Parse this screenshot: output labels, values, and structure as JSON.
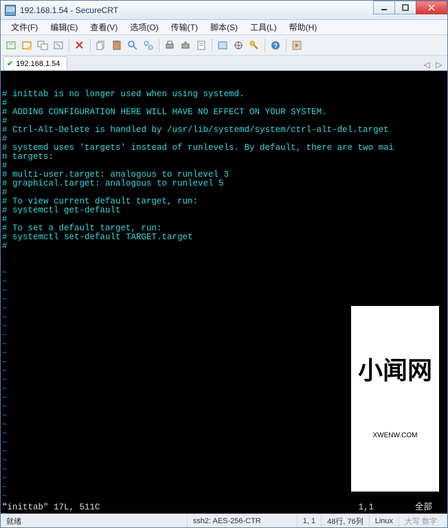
{
  "window": {
    "title": "192.168.1.54 - SecureCRT"
  },
  "menu": [
    "文件(F)",
    "编辑(E)",
    "查看(V)",
    "选项(O)",
    "传输(T)",
    "脚本(S)",
    "工具(L)",
    "帮助(H)"
  ],
  "tab": {
    "label": "192.168.1.54",
    "check": "✔"
  },
  "tabnav": {
    "left": "◁",
    "right": "▷"
  },
  "terminal": {
    "lines": [
      "# inittab is no longer used when using systemd.",
      "#",
      "# ADDING CONFIGURATION HERE WILL HAVE NO EFFECT ON YOUR SYSTEM.",
      "#",
      "# Ctrl-Alt-Delete is handled by /usr/lib/systemd/system/ctrl-alt-del.target",
      "#",
      "# systemd uses 'targets' instead of runlevels. By default, there are two mai",
      "n targets:",
      "#",
      "# multi-user.target: analogous to runlevel 3",
      "# graphical.target: analogous to runlevel 5",
      "#",
      "# To view current default target, run:",
      "# systemctl get-default",
      "#",
      "# To set a default target, run:",
      "# systemctl set-default TARGET.target",
      "#"
    ],
    "tilde_count": 28,
    "status_left": "\"inittab\" 17L, 511C",
    "status_right": "1,1        全部"
  },
  "statusbar": {
    "ready": "就绪",
    "conn": "ssh2: AES-256-CTR",
    "pos": "1,  1",
    "size": "48行, 76列",
    "mode": "Linux",
    "caps": "大写 数字"
  },
  "watermark": {
    "big": "小闻网",
    "sub": "XWENW.COM"
  }
}
